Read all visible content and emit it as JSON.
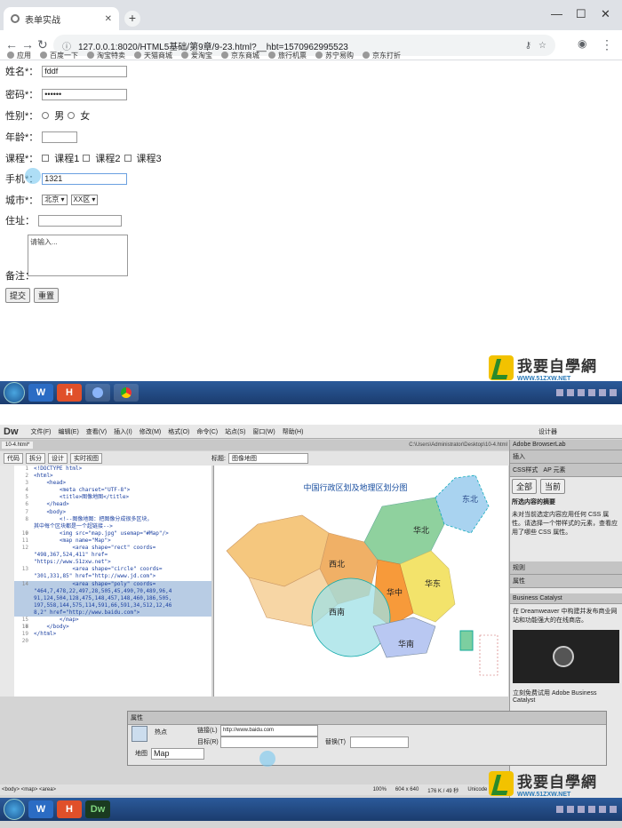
{
  "browser": {
    "tab_title": "表单实战",
    "url": "127.0.0.1:8020/HTML5基础/第9章/9-23.html?__hbt=1570962995523",
    "bookmarks": [
      "应用",
      "百度一下",
      "淘宝特卖",
      "天猫商城",
      "爱淘宝",
      "京东商城",
      "旅行机票",
      "苏宁易购",
      "京东打折"
    ]
  },
  "form": {
    "name_label": "姓名*：",
    "name_value": "fddf",
    "password_label": "密码*：",
    "password_value": "••••••",
    "gender_label": "性别*：",
    "gender_male": "男",
    "gender_female": "女",
    "age_label": "年龄*：",
    "course_label": "课程*：",
    "course1": "课程1",
    "course2": "课程2",
    "course3": "课程3",
    "phone_label": "手机*：",
    "phone_value": "1321",
    "city_label": "城市*：",
    "city_value": "北京",
    "district_value": "XX区",
    "address_label": "住址：",
    "notes_label": "备注：",
    "notes_placeholder": "请输入...",
    "submit": "提交",
    "reset": "重置"
  },
  "watermark": {
    "title": "我要自學網",
    "url": "WWW.51ZXW.NET"
  },
  "taskbar_top": {
    "apps": [
      "W",
      "H",
      "",
      ""
    ]
  },
  "dreamweaver": {
    "app_logo": "Dw",
    "menu": [
      "文件(F)",
      "编辑(E)",
      "查看(V)",
      "插入(I)",
      "修改(M)",
      "格式(O)",
      "命令(C)",
      "站点(S)",
      "窗口(W)",
      "帮助(H)"
    ],
    "workspace": "设计器",
    "doc_tab": "10-4.html*",
    "doc_path": "C:\\Users\\Administrator\\Desktop\\10-4.html",
    "toolbar": [
      "代码",
      "拆分",
      "设计",
      "实时视图"
    ],
    "title_label": "标题:",
    "title_value": "图像地图",
    "code_lines": [
      {
        "n": "1",
        "t": "<!DOCTYPE html>"
      },
      {
        "n": "2",
        "t": "<html>"
      },
      {
        "n": "3",
        "t": "    <head>"
      },
      {
        "n": "4",
        "t": "        <meta charset=\"UTF-8\">"
      },
      {
        "n": "5",
        "t": "        <title>图像地图</title>"
      },
      {
        "n": "6",
        "t": "    </head>"
      },
      {
        "n": "7",
        "t": "    <body>"
      },
      {
        "n": "8",
        "t": "        <!--图像地图：把图像分成很多区块，"
      },
      {
        "n": "",
        "t": "其中每个区块都是一个超链接-->"
      },
      {
        "n": "9",
        "t": ""
      },
      {
        "n": "10",
        "t": "        <img src=\"map.jpg\" usemap=\"#Map\"/>"
      },
      {
        "n": "11",
        "t": "        <map name=\"Map\">"
      },
      {
        "n": "12",
        "t": "            <area shape=\"rect\" coords="
      },
      {
        "n": "",
        "t": "\"498,367,524,411\" href="
      },
      {
        "n": "",
        "t": "\"https://www.51zxw.net\">"
      },
      {
        "n": "13",
        "t": "            <area shape=\"circle\" coords="
      },
      {
        "n": "",
        "t": "\"301,331,85\" href=\"http://www.jd.com\">"
      },
      {
        "n": "14",
        "t": "            <area shape=\"poly\" coords="
      },
      {
        "n": "",
        "t": "\"464,7,478,22,497,28,505,45,490,70,489,96,4"
      },
      {
        "n": "",
        "t": "91,124,504,128,475,148,457,148,460,186,505,"
      },
      {
        "n": "",
        "t": "197,558,144,575,114,591,66,591,34,512,12,46"
      },
      {
        "n": "",
        "t": "8,2\" href=\"http://www.baidu.com\">"
      },
      {
        "n": "15",
        "t": "        </map>"
      },
      {
        "n": "16",
        "t": ""
      },
      {
        "n": "17",
        "t": ""
      },
      {
        "n": "18",
        "t": "    </body>"
      },
      {
        "n": "19",
        "t": "</html>"
      },
      {
        "n": "20",
        "t": ""
      }
    ],
    "map_title": "中国行政区划及地理区划分图",
    "map_regions": [
      "西北",
      "华北",
      "东北",
      "西南",
      "华中",
      "华东",
      "华南"
    ],
    "panels": {
      "browserlab": "Adobe BrowserLab",
      "insert": "插入",
      "css_tab": "CSS样式",
      "ap_tab": "AP 元素",
      "all": "全部",
      "current": "当前",
      "rules_title": "所选内容的摘要",
      "rules_text": "未对当前选定内容应用任何 CSS 属性。请选择一个带样式的元素，查看应用了哪些 CSS 属性。",
      "rules_label": "规则",
      "props_label": "属性",
      "catalyst": "Business Catalyst",
      "catalyst_text": "在 Dreamweaver 中构建并发布商业网站和功能强大的在线商店。",
      "catalyst_cta": "立刻免费试用 Adobe Business Catalyst"
    },
    "properties": {
      "title": "属性",
      "hotspot": "热点",
      "link_label": "链接(L)",
      "link_value": "http://www.baidu.com",
      "target_label": "目标(R)",
      "alt_label": "替换(T)",
      "map_label": "地图",
      "map_value": "Map"
    },
    "statusbar": {
      "tags": "<body> <map> <area>",
      "zoom": "100%",
      "dims": "604 x 640",
      "size": "176 K / 49 秒",
      "encoding": "Unicode (UTF-8)"
    }
  },
  "taskbar_bottom": {
    "apps": [
      "W",
      "H",
      "Dw"
    ]
  }
}
